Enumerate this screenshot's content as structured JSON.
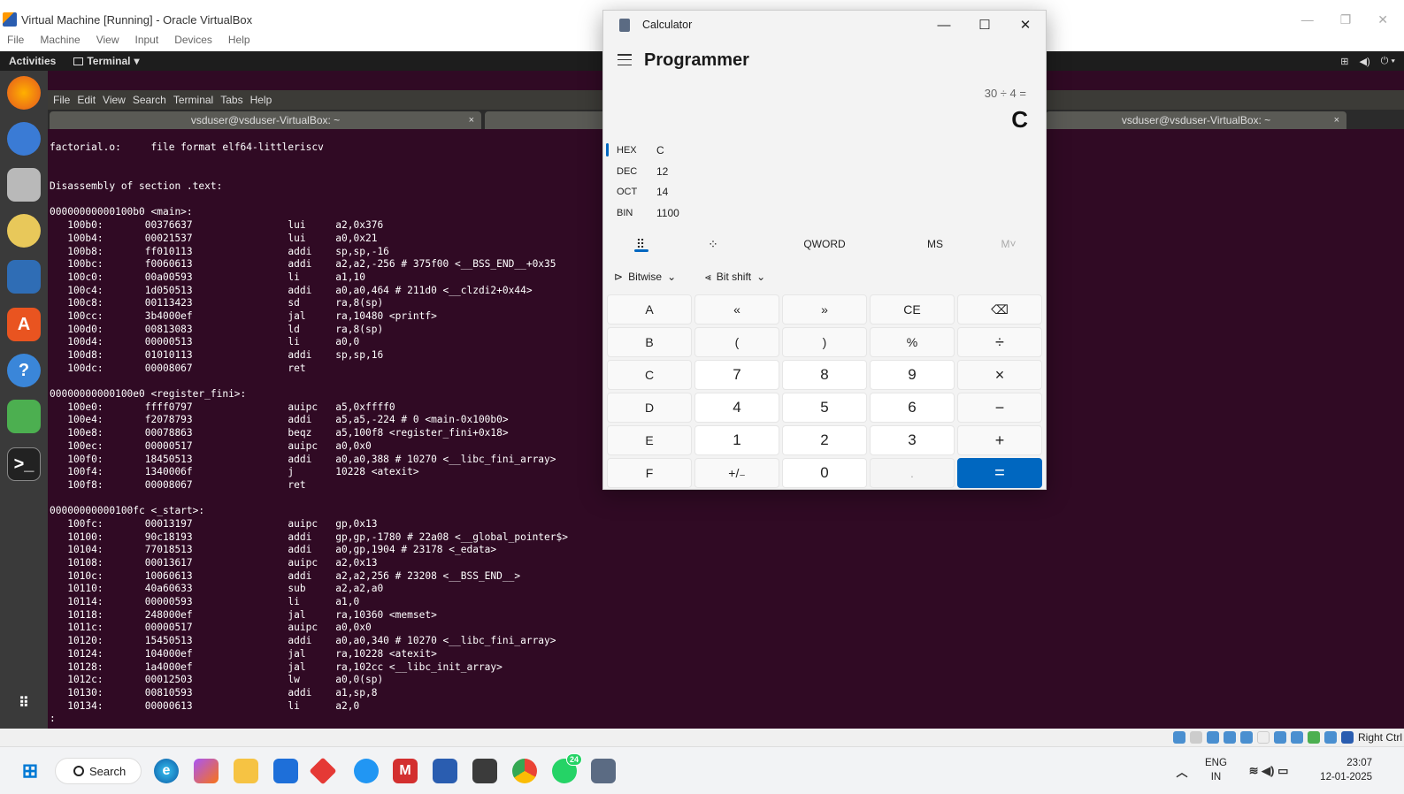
{
  "vbox": {
    "title": "Virtual Machine [Running] - Oracle VirtualBox",
    "menu": [
      "File",
      "Machine",
      "View",
      "Input",
      "Devices",
      "Help"
    ],
    "status_label": "Right Ctrl"
  },
  "gnome": {
    "activities": "Activities",
    "app": "Terminal"
  },
  "terminal": {
    "menu": [
      "File",
      "Edit",
      "View",
      "Search",
      "Terminal",
      "Tabs",
      "Help"
    ],
    "tab1": "vsduser@vsduser-VirtualBox: ~",
    "tab3": "vsduser@vsduser-VirtualBox: ~",
    "tab_close": "×",
    "lines": [
      "factorial.o:     file format elf64-littleriscv",
      "",
      "",
      "Disassembly of section .text:",
      "",
      "00000000000100b0 <main>:",
      "   100b0:       00376637                lui     a2,0x376",
      "   100b4:       00021537                lui     a0,0x21",
      "   100b8:       ff010113                addi    sp,sp,-16",
      "   100bc:       f0060613                addi    a2,a2,-256 # 375f00 <__BSS_END__+0x35",
      "   100c0:       00a00593                li      a1,10",
      "   100c4:       1d050513                addi    a0,a0,464 # 211d0 <__clzdi2+0x44>",
      "   100c8:       00113423                sd      ra,8(sp)",
      "   100cc:       3b4000ef                jal     ra,10480 <printf>",
      "   100d0:       00813083                ld      ra,8(sp)",
      "   100d4:       00000513                li      a0,0",
      "   100d8:       01010113                addi    sp,sp,16",
      "   100dc:       00008067                ret",
      "",
      "00000000000100e0 <register_fini>:",
      "   100e0:       ffff0797                auipc   a5,0xffff0",
      "   100e4:       f2078793                addi    a5,a5,-224 # 0 <main-0x100b0>",
      "   100e8:       00078863                beqz    a5,100f8 <register_fini+0x18>",
      "   100ec:       00000517                auipc   a0,0x0",
      "   100f0:       18450513                addi    a0,a0,388 # 10270 <__libc_fini_array>",
      "   100f4:       1340006f                j       10228 <atexit>",
      "   100f8:       00008067                ret",
      "",
      "00000000000100fc <_start>:",
      "   100fc:       00013197                auipc   gp,0x13",
      "   10100:       90c18193                addi    gp,gp,-1780 # 22a08 <__global_pointer$>",
      "   10104:       77018513                addi    a0,gp,1904 # 23178 <_edata>",
      "   10108:       00013617                auipc   a2,0x13",
      "   1010c:       10060613                addi    a2,a2,256 # 23208 <__BSS_END__>",
      "   10110:       40a60633                sub     a2,a2,a0",
      "   10114:       00000593                li      a1,0",
      "   10118:       248000ef                jal     ra,10360 <memset>",
      "   1011c:       00000517                auipc   a0,0x0",
      "   10120:       15450513                addi    a0,a0,340 # 10270 <__libc_fini_array>",
      "   10124:       104000ef                jal     ra,10228 <atexit>",
      "   10128:       1a4000ef                jal     ra,102cc <__libc_init_array>",
      "   1012c:       00012503                lw      a0,0(sp)",
      "   10130:       00810593                addi    a1,sp,8",
      "   10134:       00000613                li      a2,0",
      ":"
    ]
  },
  "calc": {
    "title": "Calculator",
    "mode": "Programmer",
    "expression": "30 ÷ 4 =",
    "result": "C",
    "bases": [
      {
        "label": "HEX",
        "value": "C"
      },
      {
        "label": "DEC",
        "value": "12"
      },
      {
        "label": "OCT",
        "value": "14"
      },
      {
        "label": "BIN",
        "value": "1100"
      }
    ],
    "word_size": "QWORD",
    "ms": "MS",
    "mv": "M˅",
    "bitwise": "Bitwise",
    "bitshift": "Bit shift",
    "keys": [
      [
        "A",
        "«",
        "»",
        "CE",
        "⌫"
      ],
      [
        "B",
        "(",
        ")",
        "%",
        "÷"
      ],
      [
        "C",
        "7",
        "8",
        "9",
        "×"
      ],
      [
        "D",
        "4",
        "5",
        "6",
        "−"
      ],
      [
        "E",
        "1",
        "2",
        "3",
        "+"
      ],
      [
        "F",
        "+/₋",
        "0",
        ".",
        "="
      ]
    ]
  },
  "taskbar": {
    "search": "Search",
    "lang1": "ENG",
    "lang2": "IN",
    "time": "23:07",
    "date": "12-01-2025",
    "whatsapp_badge": "24"
  }
}
